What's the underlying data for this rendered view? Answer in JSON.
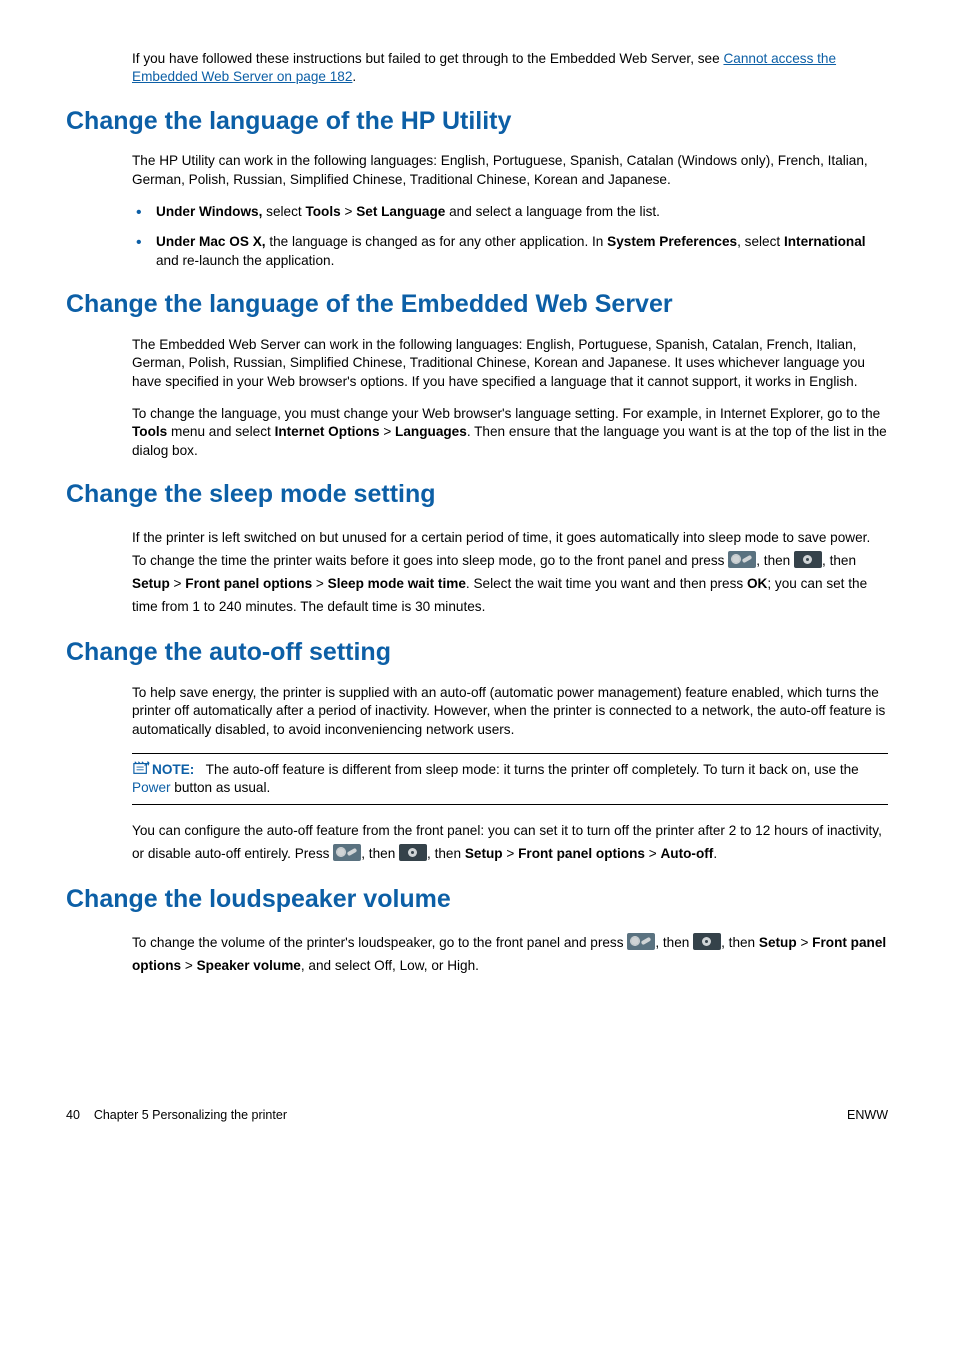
{
  "intro": {
    "p1a": "If you have followed these instructions but failed to get through to the Embedded Web Server, see ",
    "link1": "Cannot access the Embedded Web Server on page 182",
    "p1b": "."
  },
  "s1": {
    "heading": "Change the language of the HP Utility",
    "p1": "The HP Utility can work in the following languages: English, Portuguese, Spanish, Catalan (Windows only), French, Italian, German, Polish, Russian, Simplified Chinese, Traditional Chinese, Korean and Japanese.",
    "b1a": "Under Windows,",
    "b1b": " select ",
    "b1c": "Tools",
    "b1d": " > ",
    "b1e": "Set Language",
    "b1f": " and select a language from the list.",
    "b2a": "Under Mac OS X,",
    "b2b": " the language is changed as for any other application. In ",
    "b2c": "System Preferences",
    "b2d": ", select ",
    "b2e": "International",
    "b2f": " and re-launch the application."
  },
  "s2": {
    "heading": "Change the language of the Embedded Web Server",
    "p1": "The Embedded Web Server can work in the following languages: English, Portuguese, Spanish, Catalan, French, Italian, German, Polish, Russian, Simplified Chinese, Traditional Chinese, Korean and Japanese. It uses whichever language you have specified in your Web browser's options. If you have specified a language that it cannot support, it works in English.",
    "p2a": "To change the language, you must change your Web browser's language setting. For example, in Internet Explorer, go to the ",
    "p2b": "Tools",
    "p2c": " menu and select ",
    "p2d": "Internet Options",
    "p2e": " > ",
    "p2f": "Languages",
    "p2g": ". Then ensure that the language you want is at the top of the list in the dialog box."
  },
  "s3": {
    "heading": "Change the sleep mode setting",
    "p1a": "If the printer is left switched on but unused for a certain period of time, it goes automatically into sleep mode to save power. To change the time the printer waits before it goes into sleep mode, go to the front panel and press ",
    "p1b": ", then ",
    "p1c": ", then ",
    "p1d": "Setup",
    "p1e": " > ",
    "p1f": "Front panel options",
    "p1g": " > ",
    "p1h": "Sleep mode wait time",
    "p1i": ". Select the wait time you want and then press ",
    "p1j": "OK",
    "p1k": "; you can set the time from 1 to 240 minutes. The default time is 30 minutes."
  },
  "s4": {
    "heading": "Change the auto-off setting",
    "p1": "To help save energy, the printer is supplied with an auto-off (automatic power management) feature enabled, which turns the printer off automatically after a period of inactivity. However, when the printer is connected to a network, the auto-off feature is automatically disabled, to avoid inconveniencing network users.",
    "note_label": "NOTE:",
    "note_a": "The auto-off feature is different from sleep mode: it turns the printer off completely. To turn it back on, use the ",
    "note_b": "Power",
    "note_c": " button as usual.",
    "p2a": "You can configure the auto-off feature from the front panel: you can set it to turn off the printer after 2 to 12 hours of inactivity, or disable auto-off entirely. Press ",
    "p2b": ", then ",
    "p2c": ", then ",
    "p2d": "Setup",
    "p2e": " > ",
    "p2f": "Front panel options",
    "p2g": " > ",
    "p2h": "Auto-off",
    "p2i": "."
  },
  "s5": {
    "heading": "Change the loudspeaker volume",
    "p1a": "To change the volume of the printer's loudspeaker, go to the front panel and press ",
    "p1b": ", then ",
    "p1c": ", then ",
    "p1d": "Setup",
    "p1e": " > ",
    "p1f": "Front panel options",
    "p1g": " > ",
    "p1h": "Speaker volume",
    "p1i": ", and select Off, Low, or High."
  },
  "footer": {
    "left_page": "40",
    "left_text": "Chapter 5   Personalizing the printer",
    "right": "ENWW"
  }
}
